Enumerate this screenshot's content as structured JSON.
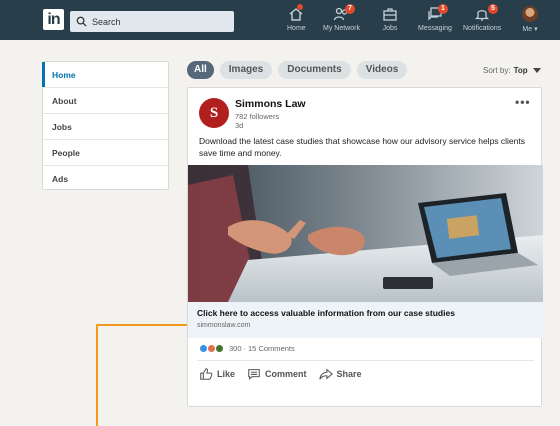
{
  "nav": {
    "logo_text": "in",
    "search_placeholder": "Search",
    "items": [
      {
        "label": "Home",
        "icon": "home-icon",
        "badge": ""
      },
      {
        "label": "My Network",
        "icon": "network-icon",
        "badge": "7"
      },
      {
        "label": "Jobs",
        "icon": "briefcase-icon",
        "badge": ""
      },
      {
        "label": "Messaging",
        "icon": "messaging-icon",
        "badge": "1"
      },
      {
        "label": "Notifications",
        "icon": "bell-icon",
        "badge": "5"
      },
      {
        "label": "Me",
        "icon": "avatar",
        "badge": ""
      }
    ]
  },
  "sidebar": {
    "items": [
      {
        "label": "Home",
        "active": true
      },
      {
        "label": "About",
        "active": false
      },
      {
        "label": "Jobs",
        "active": false
      },
      {
        "label": "People",
        "active": false
      },
      {
        "label": "Ads",
        "active": false
      }
    ]
  },
  "filters": {
    "pills": [
      "All",
      "Images",
      "Documents",
      "Videos"
    ],
    "sort_prefix": "Sort by:",
    "sort_value": "Top"
  },
  "post": {
    "company_initial": "S",
    "company_name": "Simmons Law",
    "followers": "782 followers",
    "age": "3d",
    "more": "•••",
    "text": "Download the latest case studies that showcase how our advisory service helps clients save time and money.",
    "link_title": "Click here to access valuable information from our case studies",
    "link_url": "simmonslaw.com",
    "reactions_count": "300",
    "separator": "·",
    "comments": "15 Comments",
    "actions": {
      "like": "Like",
      "comment": "Comment",
      "share": "Share"
    }
  },
  "colors": {
    "nav_bg": "#283e4a",
    "accent": "#0073b1",
    "badge": "#e34a2b",
    "brand_red": "#b21f1f",
    "callout": "#f39a1c"
  }
}
